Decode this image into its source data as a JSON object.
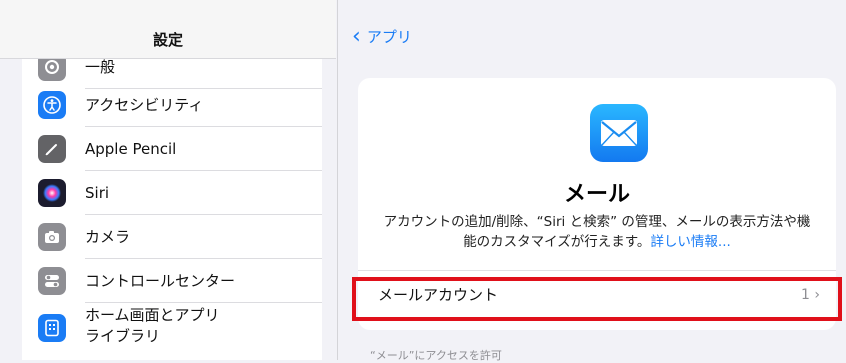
{
  "sidebar": {
    "title": "設定",
    "items": [
      {
        "label": "一般",
        "icon": "gear-icon",
        "color": "#8e8e93"
      },
      {
        "label": "アクセシビリティ",
        "icon": "accessibility-icon",
        "color": "#1a7cf5"
      },
      {
        "label": "Apple Pencil",
        "icon": "pencil-icon",
        "color": "#636366"
      },
      {
        "label": "Siri",
        "icon": "siri-icon",
        "color": "#1c1c2e"
      },
      {
        "label": "カメラ",
        "icon": "camera-icon",
        "color": "#8e8e93"
      },
      {
        "label": "コントロールセンター",
        "icon": "toggle-icon",
        "color": "#8e8e93"
      },
      {
        "label": "ホーム画面とアプリ\nライブラリ",
        "label_line1": "ホーム画面とアプリ",
        "label_line2": "ライブラリ",
        "icon": "home-screen-icon",
        "color": "#1a7cf5"
      }
    ]
  },
  "detail": {
    "back_label": "アプリ",
    "app_name": "メール",
    "description": "アカウントの追加/削除、“Siri と検索” の管理、メールの表示方法や機能のカスタマイズが行えます。",
    "link_label": "詳しい情報...",
    "account_row": {
      "label": "メールアカウント",
      "count": "1"
    },
    "section_caption": "“メール”にアクセスを許可"
  },
  "colors": {
    "accent": "#1a7cf5",
    "highlight": "#e0101a"
  }
}
